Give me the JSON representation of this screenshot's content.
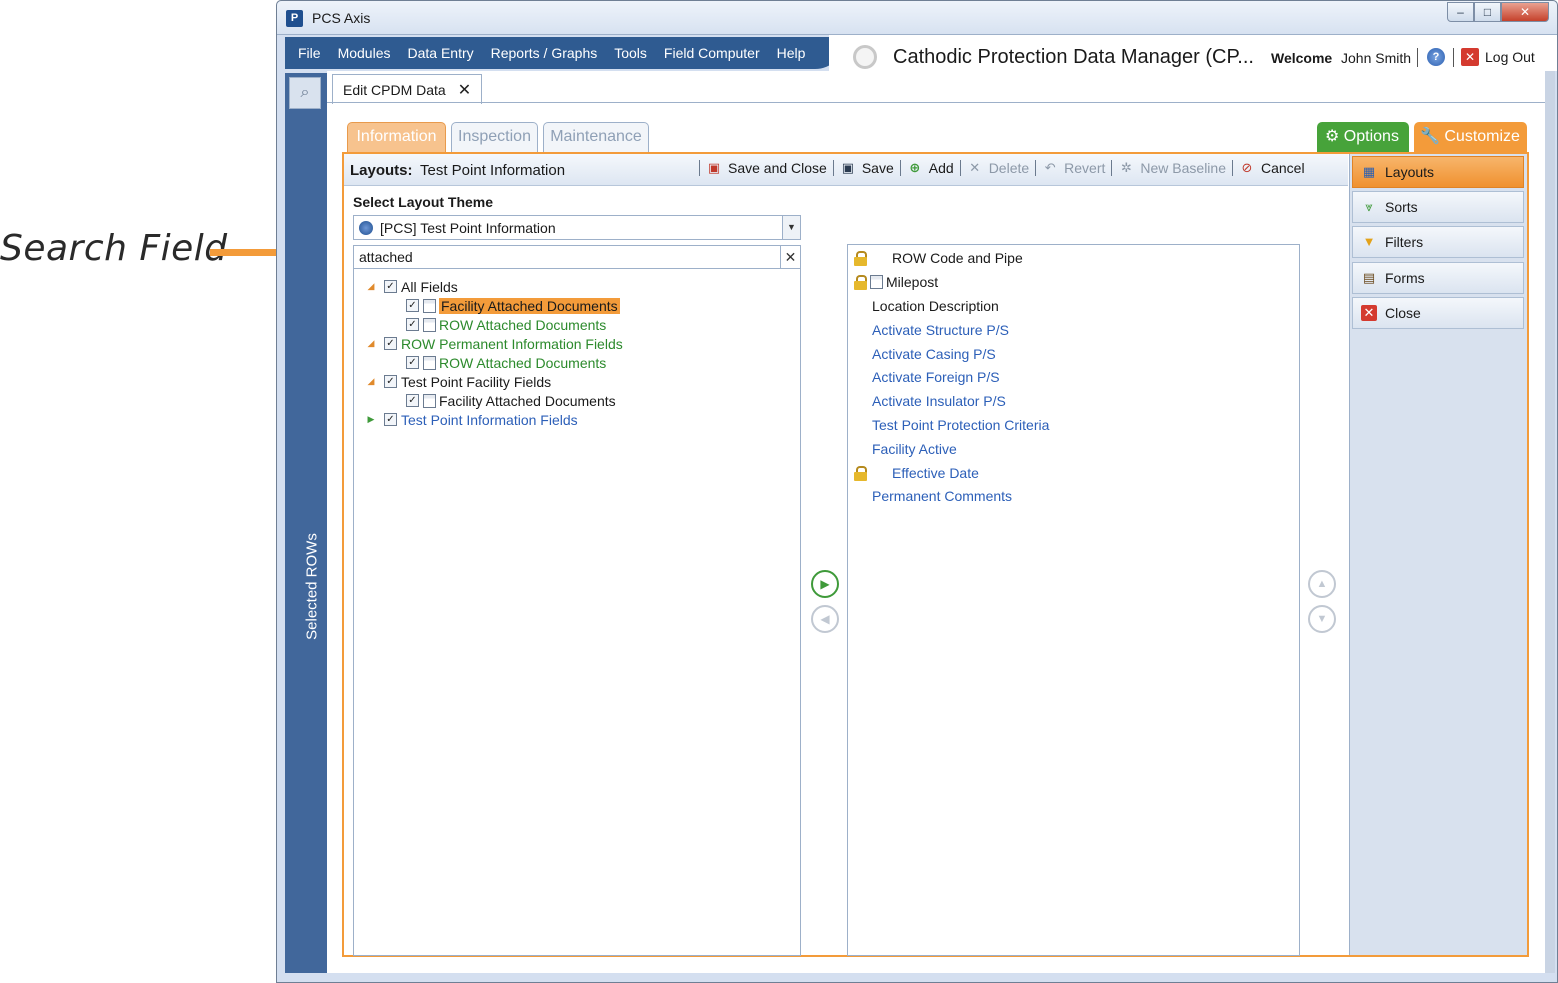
{
  "callout": {
    "text": "Search Field"
  },
  "window": {
    "title": "PCS Axis",
    "controls": {
      "minimize": "–",
      "maximize": "□",
      "close": "✕"
    }
  },
  "menu": {
    "items": [
      "File",
      "Modules",
      "Data Entry",
      "Reports / Graphs",
      "Tools",
      "Field Computer",
      "Help"
    ]
  },
  "header": {
    "app_title": "Cathodic Protection Data Manager (CP...",
    "welcome": "Welcome",
    "user": "John Smith",
    "logout": "Log Out"
  },
  "left_rail": {
    "label": "Selected ROWs"
  },
  "doc_tab": {
    "label": "Edit CPDM Data",
    "close": "✕"
  },
  "sub_tabs": [
    "Information",
    "Inspection",
    "Maintenance"
  ],
  "options_label": "Options",
  "customize_label": "Customize",
  "toolbar": {
    "layouts_label": "Layouts:",
    "layouts_value": "Test Point Information",
    "buttons": {
      "save_close": "Save and Close",
      "save": "Save",
      "add": "Add",
      "delete": "Delete",
      "revert": "Revert",
      "new_baseline": "New Baseline",
      "cancel": "Cancel"
    }
  },
  "theme": {
    "label": "Select Layout Theme",
    "value": "[PCS] Test Point Information"
  },
  "search": {
    "value": "attached",
    "clear": "✕"
  },
  "tree": [
    {
      "label": "All Fields"
    },
    {
      "label": "Facility Attached Documents"
    },
    {
      "label": "ROW Attached Documents"
    },
    {
      "label": "ROW Permanent Information Fields"
    },
    {
      "label": "ROW Attached Documents"
    },
    {
      "label": "Test Point Facility Fields"
    },
    {
      "label": "Facility Attached Documents"
    },
    {
      "label": "Test Point Information Fields"
    }
  ],
  "selected_fields": [
    {
      "label": "ROW Code and Pipe"
    },
    {
      "label": "Milepost"
    },
    {
      "label": "Location Description"
    },
    {
      "label": "Activate Structure P/S"
    },
    {
      "label": "Activate Casing P/S"
    },
    {
      "label": "Activate Foreign P/S"
    },
    {
      "label": "Activate Insulator P/S"
    },
    {
      "label": "Test Point Protection Criteria"
    },
    {
      "label": "Facility Active"
    },
    {
      "label": "Effective Date"
    },
    {
      "label": "Permanent Comments"
    }
  ],
  "side_nav": [
    "Layouts",
    "Sorts",
    "Filters",
    "Forms",
    "Close"
  ],
  "colors": {
    "accent_orange": "#f39b3a",
    "options_green": "#47a33a",
    "rail_blue": "#41679b",
    "field_blue": "#2c5fb8",
    "field_green": "#2c8a2c"
  }
}
